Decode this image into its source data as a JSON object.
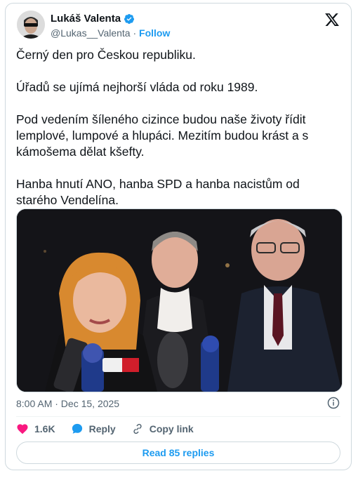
{
  "author": {
    "display_name": "Lukáš Valenta",
    "handle": "@Lukas__Valenta",
    "separator": "·",
    "follow_label": "Follow",
    "verified_color": "#1d9bf0"
  },
  "tweet": {
    "paragraphs": [
      "Černý den pro Českou republiku.",
      "Úřadů se ujímá nejhorší vláda od roku 1989.",
      "Pod vedením šíleného cizince budou naše životy řídit\nlemplové, lumpové a hlupáci. Mezitím budou krást a s\nkámošema dělat kšefty.",
      "Hanba hnutí ANO, hanba SPD a hanba nacistům od\nstarého Vendelína."
    ],
    "timestamp": "8:00 AM · Dec 15, 2025"
  },
  "actions": {
    "like_count": "1.6K",
    "reply_label": "Reply",
    "copy_link_label": "Copy link",
    "read_replies_label": "Read 85 replies"
  },
  "icons": {
    "brand": "x-logo-icon",
    "like": "heart-icon",
    "reply": "speech-bubble-icon",
    "copy": "link-icon",
    "info": "info-icon",
    "verified": "verified-badge-icon"
  },
  "colors": {
    "accent": "#1d9bf0",
    "like": "#f91880",
    "text": "#0f1419",
    "muted": "#536471",
    "border": "#cfd9de"
  }
}
